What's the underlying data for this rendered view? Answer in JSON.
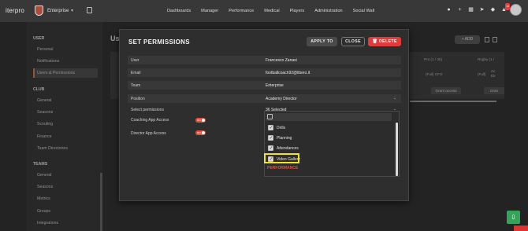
{
  "topbar": {
    "logo": "iterpro",
    "club": "Enterprise",
    "nav": [
      "Dashboards",
      "Manager",
      "Performance",
      "Medical",
      "Players",
      "Administration",
      "Social Wall"
    ],
    "notification_count": "14"
  },
  "sidebar": {
    "user_section": "USER",
    "user_items": [
      "Personal",
      "Notifications",
      "Users & Permissions"
    ],
    "club_section": "CLUB",
    "club_items": [
      "General",
      "Seasons",
      "Scouting",
      "Finance",
      "Team Directories"
    ],
    "teams_section": "TEAMS",
    "teams_items": [
      "General",
      "Seasons",
      "Metrics",
      "Groups",
      "Integrations"
    ]
  },
  "background": {
    "page_title": "Us",
    "add_label": "+ ADD",
    "col_pro": "Pro (1 / 30)",
    "col_rugby": "Rugby (1 /",
    "cell_full_cfo": "(Full)  CFO",
    "cell_full_ac": "(Full)",
    "cell_ac": "Ac",
    "cell_dir": "Dir",
    "grant_access": "Grant access",
    "grant_short": "Gran"
  },
  "modal": {
    "title": "SET PERMISSIONS",
    "apply_label": "APPLY TO",
    "close_label": "CLOSE",
    "delete_label": "DELETE",
    "rows": {
      "user_label": "User",
      "user_value": "Francesco Zanasi",
      "email_label": "Email",
      "email_value": "footballcoach92@libero.it",
      "team_label": "Team",
      "team_value": "Enterprise",
      "position_label": "Position",
      "position_value": "Academy Director",
      "select_permissions_label": "Select permissions",
      "select_permissions_value": "36 Selected",
      "coaching_app_label": "Coaching App Access",
      "director_app_label": "Director App Access",
      "toggle_text": "ON"
    },
    "dropdown": {
      "items": [
        "Drills",
        "Planning",
        "Attendances",
        "Video Gallery"
      ],
      "group_heading": "PERFORMANCE"
    }
  },
  "colors": {
    "accent_red": "#e23b3b",
    "highlight_yellow": "#f2e21c",
    "toggle_on": "#e0503a"
  }
}
